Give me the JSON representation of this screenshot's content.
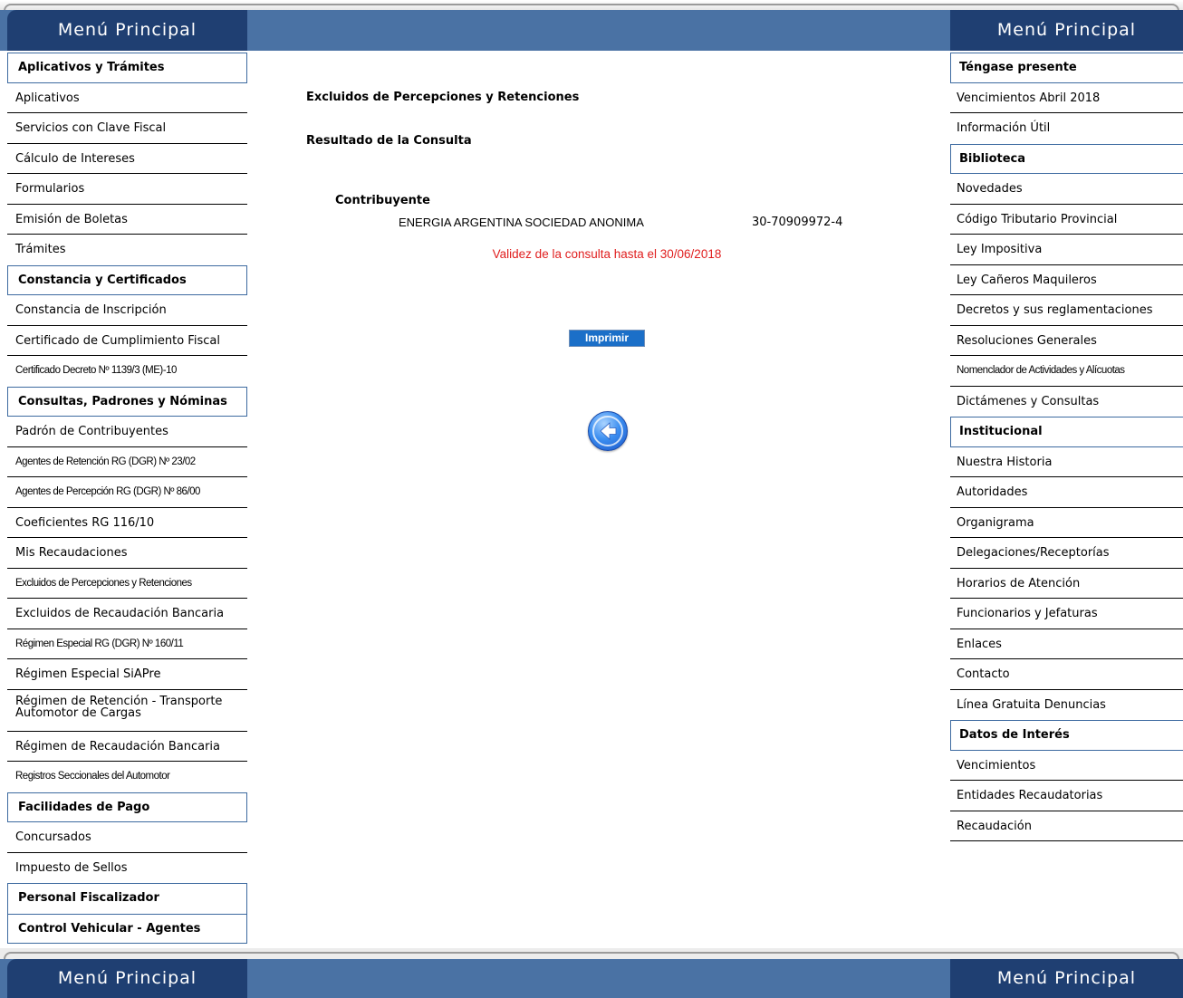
{
  "header": {
    "menu_left": "Menú Principal",
    "menu_right": "Menú Principal"
  },
  "footer": {
    "menu_left": "Menú Principal",
    "menu_right": "Menú Principal"
  },
  "left_sidebar": {
    "sections": [
      {
        "title": "Aplicativos y Trámites",
        "items": [
          "Aplicativos",
          "Servicios con Clave Fiscal",
          "Cálculo de Intereses",
          "Formularios",
          "Emisión de Boletas",
          "Trámites"
        ]
      },
      {
        "title": "Constancia y Certificados",
        "items": [
          "Constancia de Inscripción",
          "Certificado de Cumplimiento Fiscal",
          "Certificado Decreto Nº 1139/3 (ME)-10"
        ]
      },
      {
        "title": "Consultas, Padrones y Nóminas",
        "items": [
          "Padrón de Contribuyentes",
          "Agentes de Retención RG (DGR) Nº 23/02",
          "Agentes de Percepción RG (DGR) Nº 86/00",
          "Coeficientes RG 116/10",
          "Mis Recaudaciones",
          "Excluidos de Percepciones y Retenciones",
          "Excluidos de Recaudación Bancaria",
          "Régimen Especial RG (DGR) Nº 160/11",
          "Régimen Especial SiAPre",
          "Régimen de Retención - Transporte Automotor de Cargas",
          "Régimen de Recaudación Bancaria",
          "Registros Seccionales del Automotor"
        ]
      },
      {
        "title": "Facilidades de Pago",
        "items": [
          "Concursados",
          "Impuesto de Sellos"
        ]
      },
      {
        "title": "Personal Fiscalizador",
        "items": []
      },
      {
        "title": "Control Vehicular - Agentes",
        "items": []
      }
    ]
  },
  "right_sidebar": {
    "sections": [
      {
        "title": "Téngase presente",
        "items": [
          "Vencimientos Abril 2018",
          "Información Útil"
        ]
      },
      {
        "title": "Biblioteca",
        "items": [
          "Novedades",
          "Código Tributario Provincial",
          "Ley Impositiva",
          "Ley Cañeros Maquileros",
          "Decretos y sus reglamentaciones",
          "Resoluciones Generales",
          "Nomenclador de Actividades y Alícuotas",
          "Dictámenes y Consultas"
        ]
      },
      {
        "title": "Institucional",
        "items": [
          "Nuestra Historia",
          "Autoridades",
          "Organigrama",
          "Delegaciones/Receptorías",
          "Horarios de Atención",
          "Funcionarios y Jefaturas",
          "Enlaces",
          "Contacto",
          "Línea Gratuita Denuncias"
        ]
      },
      {
        "title": "Datos de Interés",
        "items": [
          "Vencimientos",
          "Entidades Recaudatorias",
          "Recaudación"
        ]
      }
    ]
  },
  "main": {
    "title": "Excluidos de Percepciones y Retenciones",
    "subtitle": "Resultado de la Consulta",
    "contribuyente_label": "Contribuyente",
    "contribuyente_name": "ENERGIA ARGENTINA SOCIEDAD ANONIMA",
    "contribuyente_cuit": "30-70909972-4",
    "validity": "Validez de la consulta hasta el 30/06/2018",
    "print_label": "Imprimir",
    "back_icon": "back-arrow-icon"
  }
}
